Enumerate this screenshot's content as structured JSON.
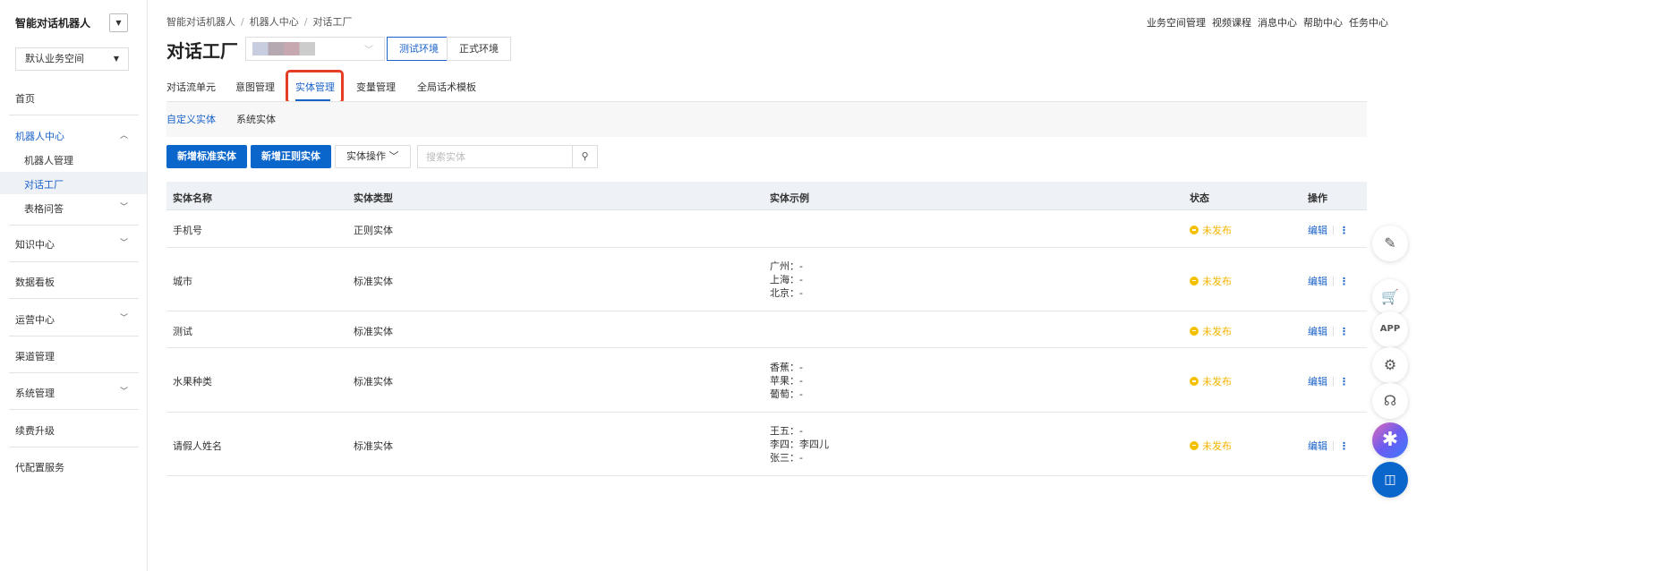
{
  "sidebar": {
    "brand": "智能对话机器人",
    "workspace": "默认业务空间",
    "items": {
      "home": "首页",
      "robot_center": "机器人中心",
      "robot_mgmt": "机器人管理",
      "dialog_factory": "对话工厂",
      "table_qa": "表格问答",
      "knowledge": "知识中心",
      "dashboard": "数据看板",
      "ops": "运营中心",
      "channel": "渠道管理",
      "system": "系统管理",
      "renew": "续费升级",
      "proxy": "代配置服务"
    }
  },
  "header": {
    "breadcrumb": [
      "智能对话机器人",
      "机器人中心",
      "对话工厂"
    ],
    "title": "对话工厂",
    "env_test": "测试环境",
    "env_prod": "正式环境",
    "top_links": [
      "业务空间管理",
      "视频课程",
      "消息中心",
      "帮助中心",
      "任务中心"
    ]
  },
  "tabs": [
    "对话流单元",
    "意图管理",
    "实体管理",
    "变量管理",
    "全局话术模板"
  ],
  "subtabs": [
    "自定义实体",
    "系统实体"
  ],
  "toolbar": {
    "add_standard": "新增标准实体",
    "add_regex": "新增正则实体",
    "entity_ops": "实体操作",
    "search_placeholder": "搜索实体"
  },
  "table": {
    "headers": [
      "实体名称",
      "实体类型",
      "实体示例",
      "状态",
      "操作"
    ],
    "rows": [
      {
        "name": "手机号",
        "type": "正则实体",
        "examples": [],
        "status": "未发布",
        "edit": "编辑"
      },
      {
        "name": "城市",
        "type": "标准实体",
        "examples": [
          "广州：-",
          "上海：-",
          "北京：-"
        ],
        "status": "未发布",
        "edit": "编辑"
      },
      {
        "name": "测试",
        "type": "标准实体",
        "examples": [],
        "status": "未发布",
        "edit": "编辑"
      },
      {
        "name": "水果种类",
        "type": "标准实体",
        "examples": [
          "香蕉：-",
          "苹果：-",
          "葡萄：-"
        ],
        "status": "未发布",
        "edit": "编辑"
      },
      {
        "name": "请假人姓名",
        "type": "标准实体",
        "examples": [
          "王五：-",
          "李四：李四儿",
          "张三：-"
        ],
        "status": "未发布",
        "edit": "编辑"
      }
    ]
  },
  "colors": {
    "primary": "#0b66cc",
    "status_unpublished": "#f5c000",
    "highlight": "#e53c24"
  }
}
